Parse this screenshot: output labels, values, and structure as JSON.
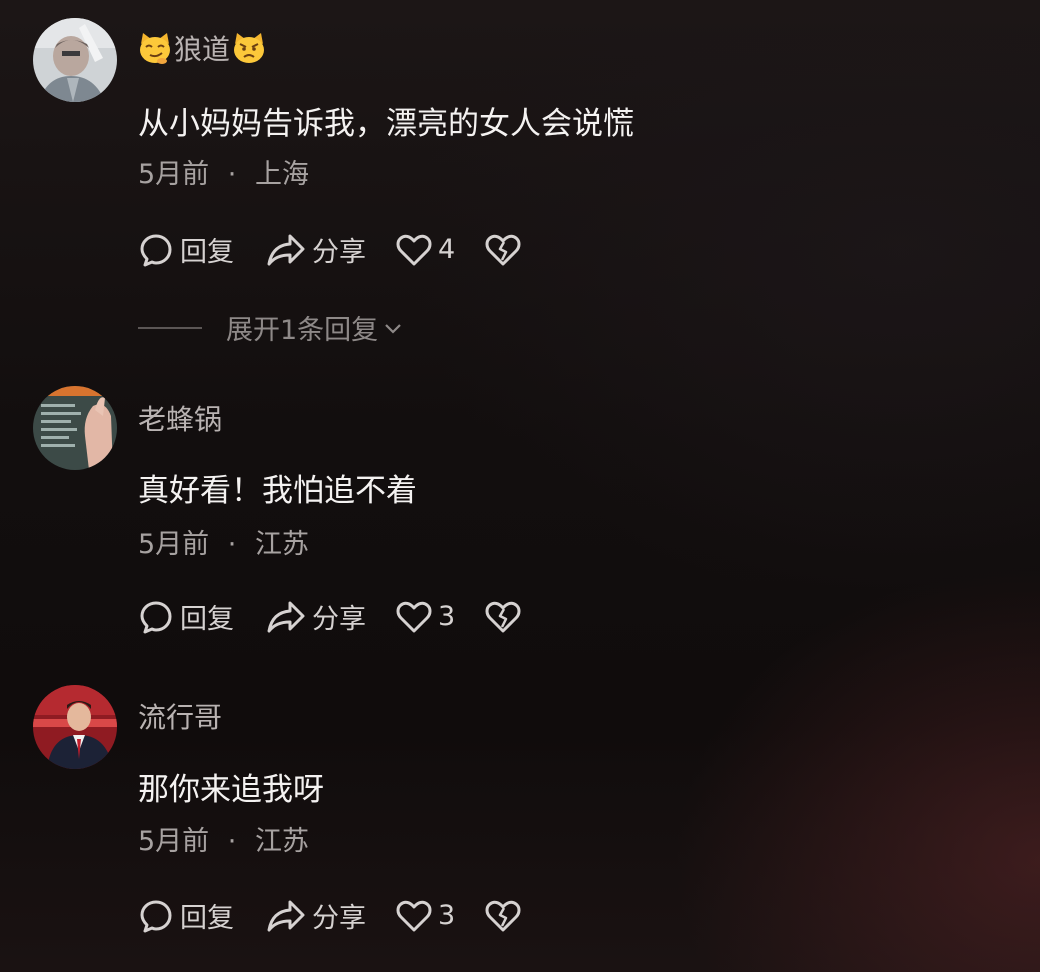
{
  "comments": [
    {
      "username": "狼道",
      "emoji_left": "smirk-cat-icon",
      "emoji_right": "pouting-cat-icon",
      "text": "从小妈妈告诉我，漂亮的女人会说慌",
      "time": "5月前",
      "separator": "·",
      "location": "上海",
      "reply_label": "回复",
      "share_label": "分享",
      "likes": "4"
    },
    {
      "username": "老蜂锅",
      "text": "真好看！我怕追不着",
      "time": "5月前",
      "separator": "·",
      "location": "江苏",
      "reply_label": "回复",
      "share_label": "分享",
      "likes": "3"
    },
    {
      "username": "流行哥",
      "text": "那你来追我呀",
      "time": "5月前",
      "separator": "·",
      "location": "江苏",
      "reply_label": "回复",
      "share_label": "分享",
      "likes": "3"
    }
  ],
  "expand_replies": {
    "label": "展开1条回复"
  },
  "colors": {
    "background": "#120e0e",
    "username": "#b9b3b2",
    "content": "#f4f2f1",
    "meta": "#a7a2a1",
    "expand": "#8e8988"
  }
}
